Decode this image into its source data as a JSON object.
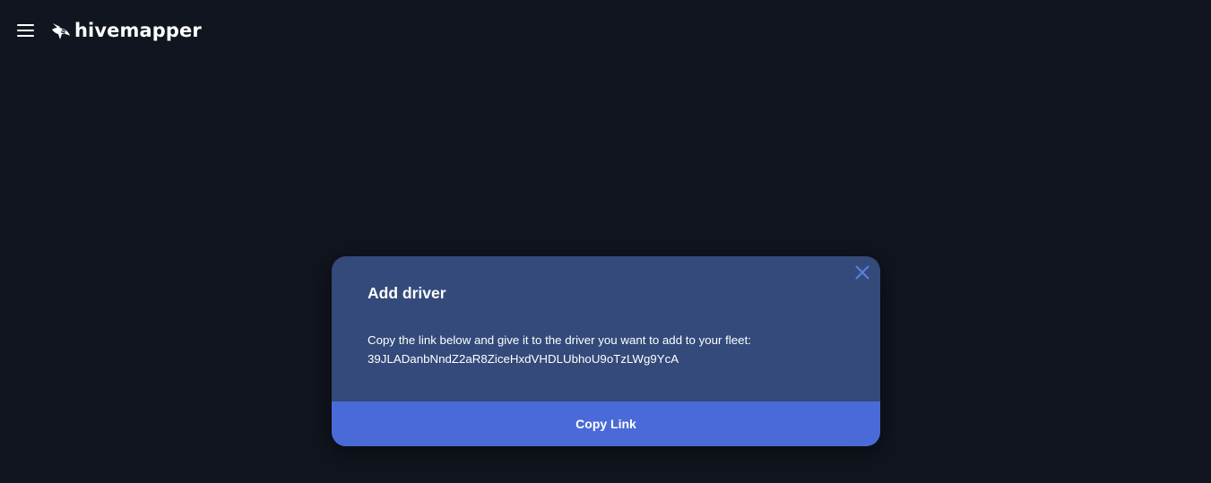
{
  "header": {
    "menu_icon": "hamburger-menu-icon",
    "logo_icon": "hivemapper-bee-logo-icon",
    "logo_text": "hivemapper"
  },
  "modal": {
    "title": "Add driver",
    "description": "Copy the link below and give it to the driver you want to add to your fleet:",
    "invite_code": "39JLADanbNndZ2aR8ZiceHxdVHDLUbhoU9oTzLWg9YcA",
    "close_icon": "close-icon",
    "copy_button_label": "Copy Link"
  },
  "colors": {
    "background": "#11151f",
    "modal_background": "#334a7a",
    "accent": "#4a6ad8",
    "close_icon": "#5b7fe0",
    "text": "#ffffff"
  }
}
